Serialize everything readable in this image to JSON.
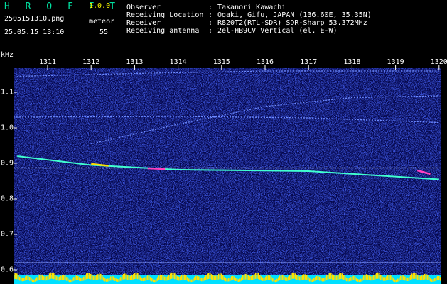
{
  "header": {
    "brand": "H R O F F T",
    "version": "1.0.0",
    "filename": "2505151310.png",
    "event_label": "meteor",
    "datetime": "25.05.15 13:10",
    "event_count": "55",
    "info": [
      {
        "label": "Observer",
        "value": "Takanori Kawachi"
      },
      {
        "label": "Receiving Location",
        "value": "Ogaki, Gifu, JAPAN (136.60E, 35.35N)"
      },
      {
        "label": "Receiver",
        "value": "R820T2(RTL-SDR) SDR-Sharp 53.372MHz"
      },
      {
        "label": "Receiving antenna",
        "value": "2el-HB9CV Vertical (el. E-W)"
      }
    ],
    "colon": ":"
  },
  "colors": {
    "brand": "#00e0a0",
    "version": "#ffff00",
    "background": "#000000",
    "noise": "#1a28c8",
    "baseline_cyan": "#00e0ff",
    "baseline_yellow": "#ffe000"
  },
  "chart_data": {
    "type": "spectrogram",
    "x_unit": "time (HHMM)",
    "y_unit": "kHz",
    "x_ticks": [
      "1311",
      "1312",
      "1313",
      "1314",
      "1315",
      "1316",
      "1317",
      "1318",
      "1319",
      "1320"
    ],
    "y_ticks": [
      "1.1",
      "1.0",
      "0.9",
      "0.8",
      "0.7",
      "0.6"
    ],
    "ylim": [
      0.6,
      1.15
    ],
    "unit_label": "kHz",
    "traces": [
      {
        "name": "steady carrier",
        "points": [
          [
            1310.0,
            0.887
          ],
          [
            1320.0,
            0.887
          ]
        ]
      },
      {
        "name": "upper drift",
        "points": [
          [
            1310.3,
            1.145
          ],
          [
            1313.0,
            1.153
          ],
          [
            1316.0,
            1.16
          ],
          [
            1320.0,
            1.16
          ]
        ]
      },
      {
        "name": "rising drift",
        "points": [
          [
            1312.0,
            0.955
          ],
          [
            1314.0,
            1.01
          ],
          [
            1316.0,
            1.06
          ],
          [
            1318.0,
            1.085
          ],
          [
            1320.0,
            1.09
          ]
        ]
      },
      {
        "name": "flat line",
        "points": [
          [
            1310.0,
            1.03
          ],
          [
            1314.0,
            1.032
          ],
          [
            1317.0,
            1.028
          ],
          [
            1320.0,
            1.015
          ]
        ]
      },
      {
        "name": "meteor trail",
        "points": [
          [
            1310.3,
            0.92
          ],
          [
            1312.0,
            0.895
          ],
          [
            1314.0,
            0.882
          ],
          [
            1317.0,
            0.878
          ],
          [
            1320.0,
            0.855
          ]
        ]
      }
    ]
  }
}
